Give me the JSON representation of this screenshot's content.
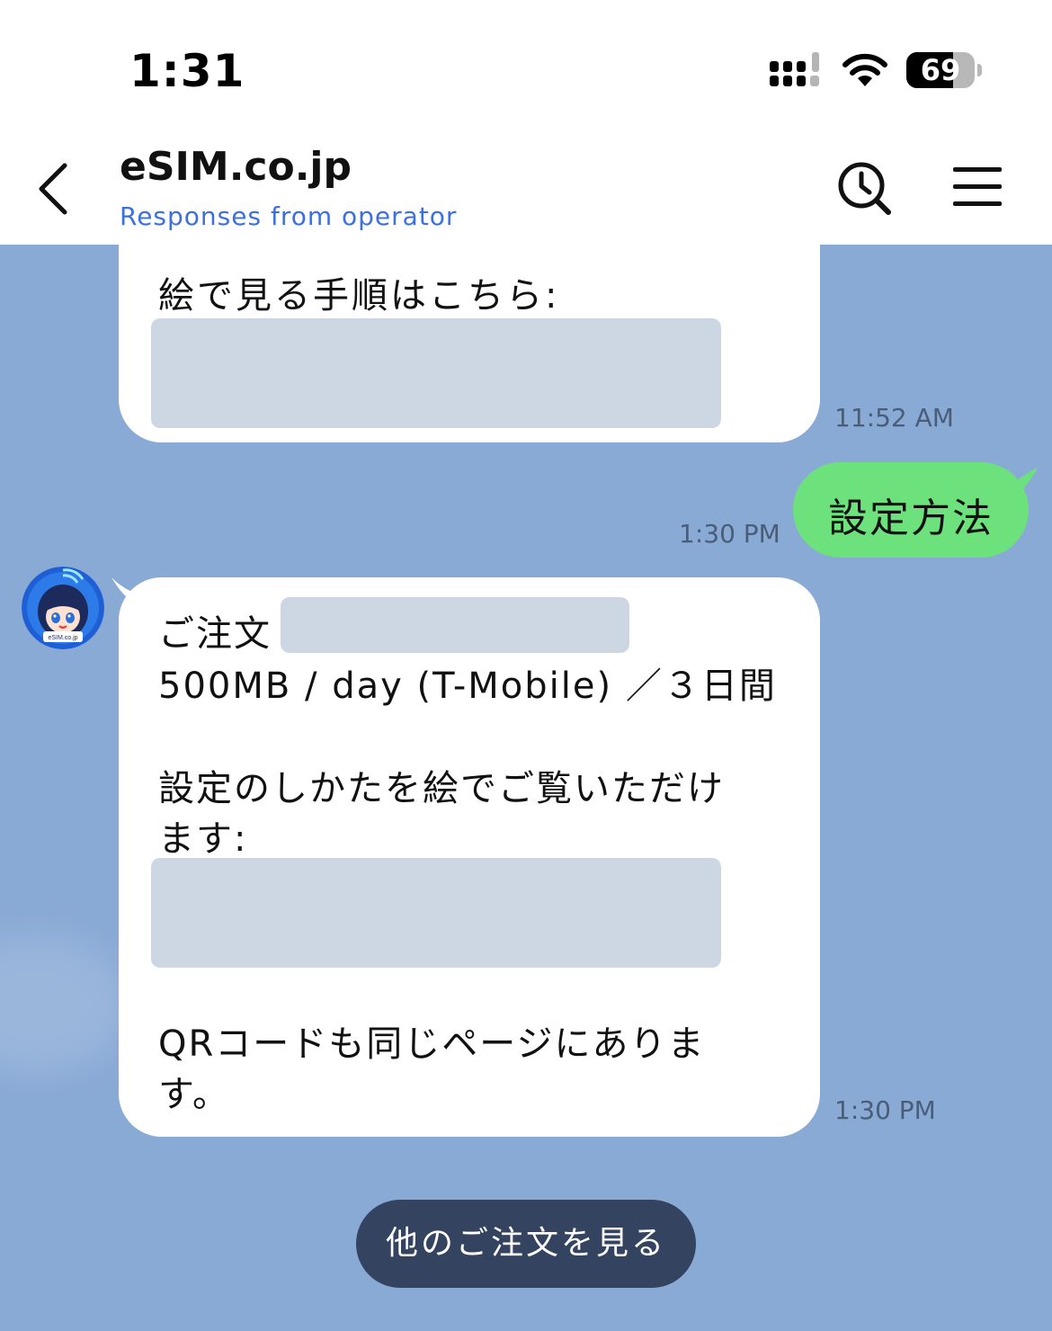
{
  "status_bar": {
    "time": "1:31",
    "battery_level": "69",
    "battery_fraction": 0.69,
    "icons": [
      "signal-icon",
      "wifi-icon",
      "battery-icon"
    ]
  },
  "header": {
    "back_icon": "chevron-left-icon",
    "title": "eSIM.co.jp",
    "subtitle": "Responses from operator",
    "search_icon": "clock-search-icon",
    "menu_icon": "hamburger-menu-icon"
  },
  "messages": [
    {
      "from": "operator",
      "lines": [
        "絵で見る手順はこちら:"
      ],
      "time": "11:52 AM"
    },
    {
      "from": "user",
      "text": "設定方法",
      "time": "1:30 PM"
    },
    {
      "from": "operator",
      "lines": [
        "ご注文",
        "500MB / day (T-Mobile) ／３日間",
        "設定のしかたを絵でご覧いただけ",
        "ます:",
        "QRコードも同じページにありま",
        "す。"
      ],
      "time": "1:30 PM"
    }
  ],
  "avatar": {
    "label": "eSIM.co.jp"
  },
  "actions": {
    "more_orders": "他のご注文を見る"
  },
  "colors": {
    "chat_background": "#8aaad6",
    "outgoing_bubble": "#6de27c",
    "incoming_bubble": "#ffffff",
    "subtitle_text": "#3c6fe0",
    "action_button": "#34435f"
  }
}
